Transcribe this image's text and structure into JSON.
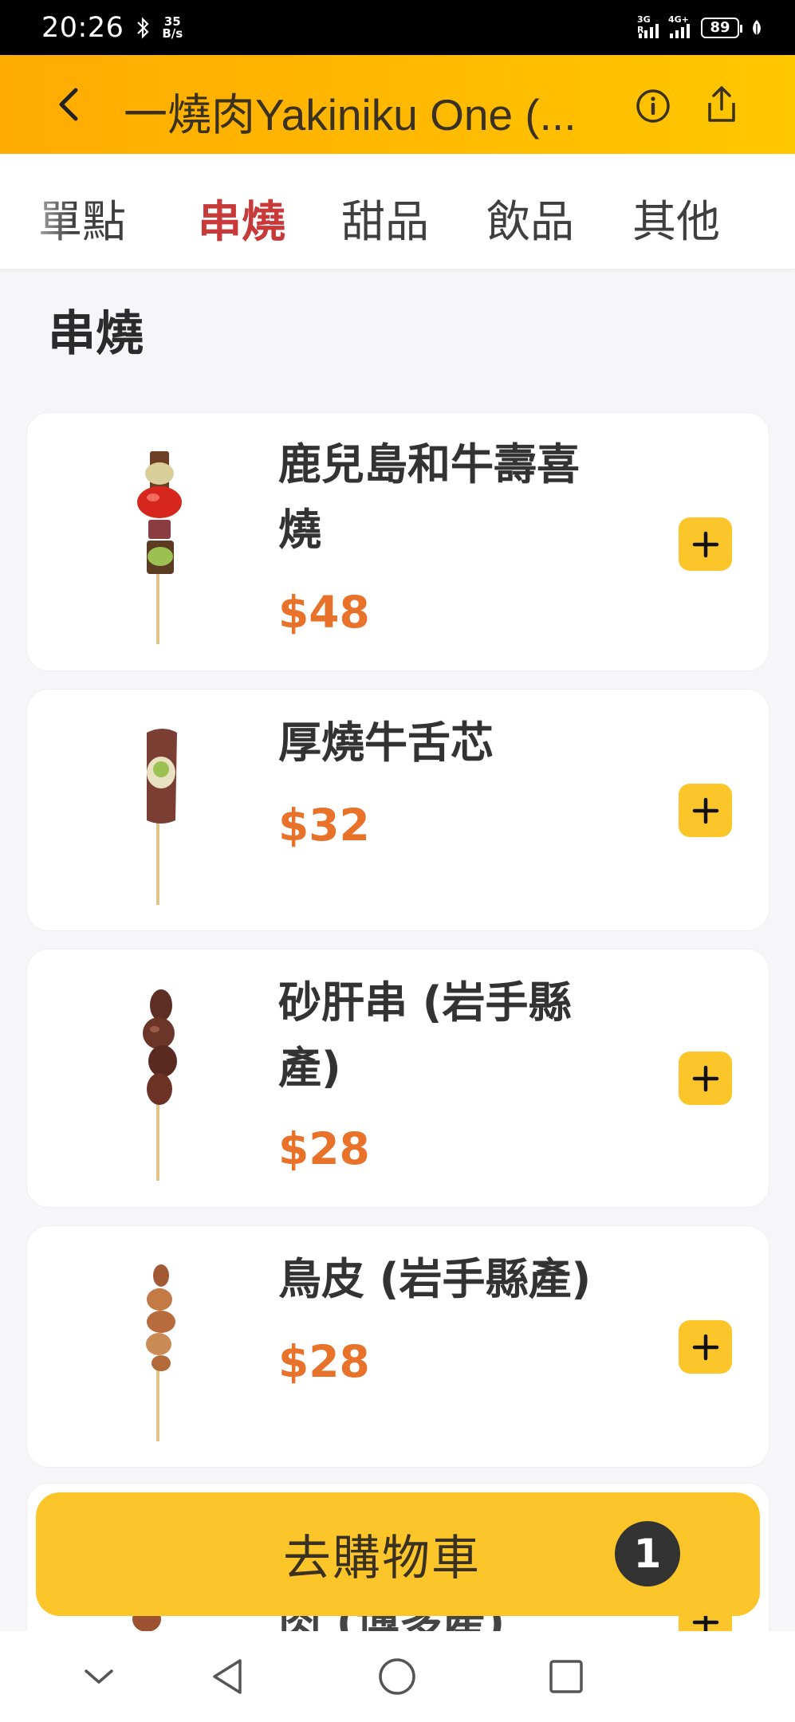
{
  "status_bar": {
    "time": "20:26",
    "net_speed_value": "35",
    "net_speed_unit": "B/s",
    "signal_1_label": "3G R",
    "signal_2_label": "4G+",
    "battery": "89"
  },
  "header": {
    "title": "一燒肉Yakiniku One (...",
    "accent_colors": [
      "#ffab00",
      "#ffc700"
    ]
  },
  "tabs": [
    {
      "label": "單點",
      "active": false
    },
    {
      "label": "串燒",
      "active": true
    },
    {
      "label": "甜品",
      "active": false
    },
    {
      "label": "飲品",
      "active": false
    },
    {
      "label": "其他",
      "active": false
    }
  ],
  "section_title": "串燒",
  "products": [
    {
      "name": "鹿兒島和牛壽喜燒",
      "price": "$48"
    },
    {
      "name": "厚燒牛舌芯",
      "price": "$32"
    },
    {
      "name": "砂肝串 (岩手縣產)",
      "price": "$28"
    },
    {
      "name": "鳥皮 (岩手縣產)",
      "price": "$28"
    }
  ],
  "peek_product_partial_text": "肉 (博多產)",
  "cart": {
    "label": "去購物車",
    "count": "1"
  },
  "colors": {
    "price": "#e8722a",
    "active_tab": "#c8393a",
    "add_button": "#fcc62b"
  },
  "icons": {
    "back": "chevron-left-icon",
    "info": "info-icon",
    "share": "share-icon",
    "add": "plus-icon",
    "nav": [
      "chevron-down-icon",
      "back-triangle-icon",
      "home-circle-icon",
      "recents-square-icon"
    ]
  }
}
